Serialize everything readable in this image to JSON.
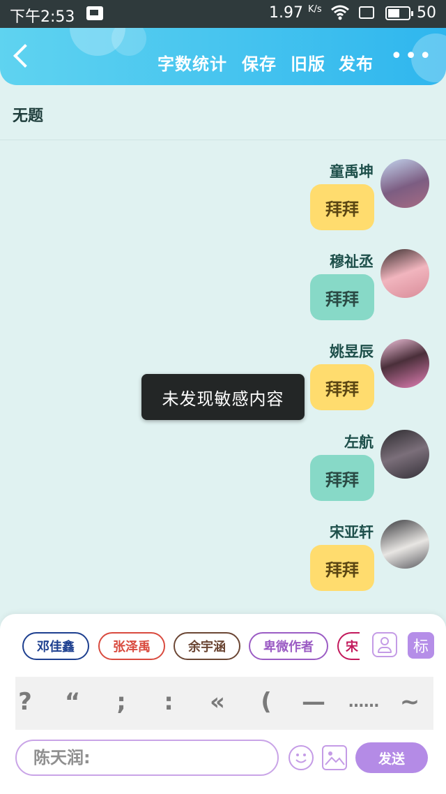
{
  "status_bar": {
    "time": "下午2:53",
    "speed_value": "1.97",
    "speed_unit": "K/s",
    "battery_pct": "50"
  },
  "header": {
    "word_count": "字数统计",
    "save": "保存",
    "old_version": "旧版",
    "publish": "发布"
  },
  "title": "无题",
  "messages": [
    {
      "name": "童禹坤",
      "text": "拜拜",
      "bubble_color": "#ffdc6e"
    },
    {
      "name": "穆祉丞",
      "text": "拜拜",
      "bubble_color": "#87d9c7"
    },
    {
      "name": "姚昱辰",
      "text": "拜拜",
      "bubble_color": "#ffdc6e"
    },
    {
      "name": "左航",
      "text": "拜拜",
      "bubble_color": "#87d9c7"
    },
    {
      "name": "宋亚轩",
      "text": "拜拜",
      "bubble_color": "#ffdc6e"
    }
  ],
  "toast": "未发现敏感内容",
  "characters": [
    {
      "label": "邓佳鑫",
      "color": "#1d3f8f"
    },
    {
      "label": "张泽禹",
      "color": "#d94a3e"
    },
    {
      "label": "余宇涵",
      "color": "#6b4634"
    },
    {
      "label": "卑微作者",
      "color": "#9b5cc4"
    },
    {
      "label": "宋",
      "color": "#c2185b"
    }
  ],
  "tag_button": "标",
  "punctuation": [
    "?",
    "“",
    ";",
    ":",
    "«",
    "(",
    "—",
    "……",
    "~"
  ],
  "input": {
    "value": "陈天润:"
  },
  "send_label": "发送"
}
